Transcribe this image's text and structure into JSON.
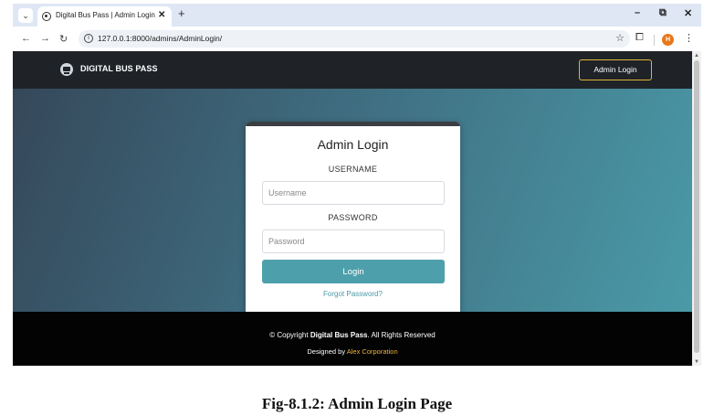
{
  "browser": {
    "tab_title": "Digital Bus Pass | Admin Login",
    "url": "127.0.0.1:8000/admins/AdminLogin/",
    "profile_initial": "H",
    "icons": {
      "tab_menu": "chevron-down-icon",
      "tab_favicon": "globe-icon",
      "tab_close": "close-icon",
      "new_tab": "plus-icon",
      "minimize": "minimize-icon",
      "restore": "restore-icon",
      "close_window": "close-icon",
      "back": "back-arrow-icon",
      "forward": "forward-arrow-icon",
      "reload": "reload-icon",
      "site_info": "info-icon",
      "bookmark": "star-icon",
      "extensions": "puzzle-icon",
      "menu": "kebab-icon"
    }
  },
  "navbar": {
    "brand": "DIGITAL BUS PASS",
    "admin_button": "Admin Login",
    "accent_color": "#e0b33a"
  },
  "login_card": {
    "title": "Admin Login",
    "username_label": "USERNAME",
    "username_placeholder": "Username",
    "password_label": "PASSWORD",
    "password_placeholder": "Password",
    "login_button": "Login",
    "forgot_link": "Forgot Password?",
    "button_color": "#4da0ab"
  },
  "footer": {
    "copyright_prefix": "© Copyright",
    "copyright_brand": "Digital Bus Pass",
    "copyright_suffix": ". All Rights Reserved",
    "designed_prefix": "Designed by",
    "designed_company": "Alex Corporation",
    "company_color": "#f0b43e"
  },
  "caption": "Fig-8.1.2: Admin Login Page"
}
